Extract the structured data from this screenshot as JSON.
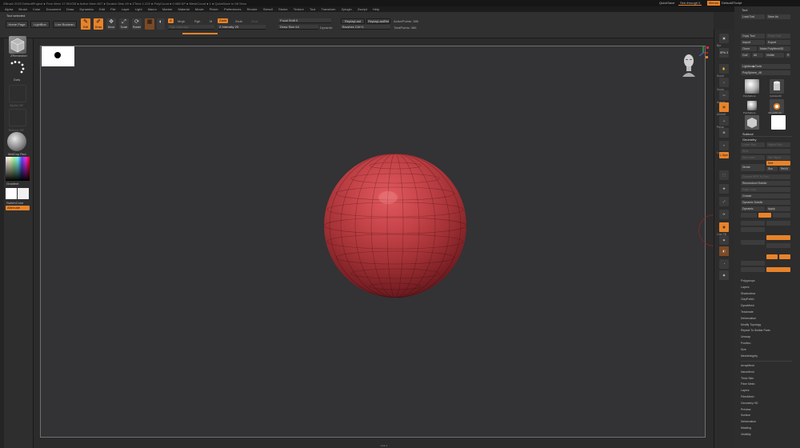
{
  "titlebar": {
    "text": "ZBrush 2023   DefaultProject   ● Free Mem 17.991GB ● Active Mem 807 ● Scratch Disk 49 ● ZTime 1.222 ● PolyCount ● 0.088 KP ● MeshCount ● 1  ● QuickSave In 08 Secs",
    "quicksave": "QuickSave",
    "seethrough": "See-through 0",
    "menus": "Menus",
    "script": "DefaultZScript"
  },
  "menubar": [
    "Alpha",
    "Brush",
    "Color",
    "Document",
    "Draw",
    "Dynamics",
    "Edit",
    "File",
    "Layer",
    "Light",
    "Macro",
    "Marker",
    "Material",
    "Movie",
    "Picker",
    "Preferences",
    "Render",
    "Stencil",
    "Stroke",
    "Texture",
    "Tool",
    "Transform",
    "Zplugin",
    "Zscript",
    "Help"
  ],
  "shelf": {
    "tool_selected": "Tool selected",
    "home_page": "Home Page",
    "lightbox": "LightBox",
    "live_boolean": "Live Boolean",
    "edit": "Edit",
    "draw": "Draw",
    "move": "Move",
    "scale": "Scale",
    "rotate": "Rotate",
    "mrgb": "Mrgb",
    "rgb": "Rgb",
    "m": "M",
    "zadd": "Zadd",
    "zsub": "Zsub",
    "zcut": "Zcut",
    "rgb_intensity": "Rgb Intensity",
    "z_intensity": "Z Intensity 25",
    "focal_shift": "Focal Shift 0",
    "draw_size": "Draw Size 64",
    "dynamic": "Dynamic",
    "replay_last": "ReplayLast",
    "replay_last_rel": "ReplayLastRel",
    "polypaint_hint": "Brushes  Ctrl+1",
    "active_points": "ActivePoints: 386",
    "total_points": "TotalPoints: 386"
  },
  "left": {
    "zremesher": "ZRemesher",
    "dots": "Dots",
    "alpha_off": "Alpha Off",
    "texture_off": "Texture Off",
    "material": "MatCap Red",
    "gradient": "Gradient",
    "switch_color": "SwitchColor",
    "alternate": "Alternate"
  },
  "right_strip": [
    "Bpr",
    "SPix 3",
    "Scroll",
    "Zoom",
    "Actual",
    "AAHalf",
    "Persp",
    "Floor",
    "Local",
    "L.Sym",
    "Frame",
    "Move",
    "Scale",
    "Rotate",
    "Line Fill",
    "PolyF",
    "Transp",
    "Ghost",
    "Solo",
    "Xpose"
  ],
  "tool_panel": {
    "title": "Tool",
    "load_tool": "Load Tool",
    "save_as": "Save As",
    "copy_tool": "Copy Tool",
    "paste_tool": "Paste Tool",
    "import": "Import",
    "export": "Export",
    "clone": "Clone",
    "make_polymesh": "Make PolyMesh3D",
    "goz": "GoZ",
    "all": "All",
    "visible": "Visible",
    "r": "R",
    "lightbox_tools": "Lightbox▶Tools",
    "polysphere": "PolySphere_48",
    "thumbs": [
      "PolySphere",
      "Cylinder3D",
      "PolySphere",
      "SimpleBrush",
      "PolyMesh3D",
      "Plane3D"
    ],
    "subtool": "Subtool",
    "geometry": "Geometry",
    "lower_res": "Lower Res",
    "higher_res": "Higher Res",
    "sdiv": "SDiv",
    "del_lower": "Del Lower",
    "del_higher": "Del Higher",
    "reconstruct_subdiv": "Reconstruct Subdiv",
    "convert_bpr": "Convert BPR To Geo",
    "divide": "Divide",
    "smt": "Smt",
    "suv": "Suv",
    "reuv": "ReUV",
    "edge_loop": "Edge Loop",
    "crease": "Crease",
    "shadowbox": "ShadowBox",
    "claypolish": "ClayPolish",
    "dynamesh": "DynaMesh",
    "tessimate": "Tessimate",
    "zremesher": "ZRemesher",
    "modify_topology": "Modify Topology",
    "position": "Position",
    "size": "Size",
    "meshintegrity": "MeshIntegrity",
    "dynamic_subdiv": "Dynamic Subdiv",
    "dynamic": "Dynamic",
    "apply": "Apply",
    "list": [
      "Polygroups",
      "Layers",
      "Shadowbox",
      "ClayPolish",
      "DynaMesh",
      "Tessimate",
      "Deformation",
      "Modify Topology",
      "Repeat To Similar Parts",
      "Unwrap",
      "Position",
      "Size",
      "MeshIntegrity"
    ],
    "list2": [
      "ArrayMesh",
      "NanoMesh",
      "Thick Skin",
      "Fiber Mesh",
      "Layers",
      "FiberMesh",
      "Geometry HD",
      "Preview",
      "Surface",
      "Deformation",
      "Masking",
      "Visibility",
      "Polygroups",
      "Contact"
    ]
  },
  "bottom": "◂  ▸▸  ▸"
}
